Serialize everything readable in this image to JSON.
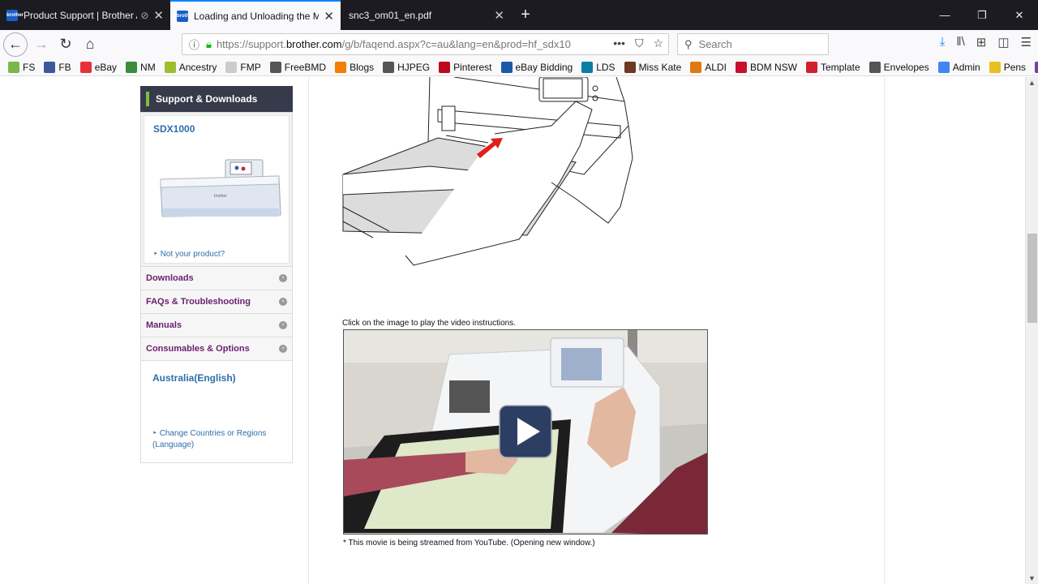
{
  "tabs": [
    {
      "title": "Product Support | Brother A",
      "active": false
    },
    {
      "title": "Loading and Unloading the Ma",
      "active": true
    },
    {
      "title": "snc3_om01_en.pdf",
      "active": false
    }
  ],
  "nav": {
    "url_prefix": "https://support.",
    "url_domain": "brother.com",
    "url_rest": "/g/b/faqend.aspx?c=au&lang=en&prod=hf_sdx10",
    "search_placeholder": "Search"
  },
  "bookmarks": [
    {
      "label": "FS",
      "icon": "tree-icon",
      "color": "#7ab648"
    },
    {
      "label": "FB",
      "icon": "facebook-icon",
      "color": "#3b5998"
    },
    {
      "label": "eBay",
      "icon": "ebay-icon",
      "color": "#e53238"
    },
    {
      "label": "NM",
      "icon": "leaf-icon",
      "color": "#3a8d3a"
    },
    {
      "label": "Ancestry",
      "icon": "ancestry-icon",
      "color": "#9cbe30"
    },
    {
      "label": "FMP",
      "icon": "fmp-icon",
      "color": "#cccccc"
    },
    {
      "label": "FreeBMD",
      "icon": "globe-icon",
      "color": "#555555"
    },
    {
      "label": "Blogs",
      "icon": "blogger-icon",
      "color": "#f57d00"
    },
    {
      "label": "HJPEG",
      "icon": "globe-icon",
      "color": "#555555"
    },
    {
      "label": "Pinterest",
      "icon": "pinterest-icon",
      "color": "#bd081c"
    },
    {
      "label": "eBay Bidding",
      "icon": "bidding-icon",
      "color": "#1c5aa8"
    },
    {
      "label": "LDS",
      "icon": "lds-icon",
      "color": "#0a7ea3"
    },
    {
      "label": "Miss Kate",
      "icon": "misskate-icon",
      "color": "#6b3a1f"
    },
    {
      "label": "ALDI",
      "icon": "pin-icon",
      "color": "#e07a10"
    },
    {
      "label": "BDM NSW",
      "icon": "bdm-icon",
      "color": "#c8102e"
    },
    {
      "label": "Template",
      "icon": "template-icon",
      "color": "#d0202e"
    },
    {
      "label": "Envelopes",
      "icon": "globe-icon",
      "color": "#555555"
    },
    {
      "label": "Admin",
      "icon": "google-icon",
      "color": "#4285f4"
    },
    {
      "label": "Pens",
      "icon": "bulb-icon",
      "color": "#e8c020"
    }
  ],
  "sidebar": {
    "header": "Support & Downloads",
    "product_name": "SDX1000",
    "not_your_product": "Not your product?",
    "menu": [
      {
        "label": "Downloads"
      },
      {
        "label": "FAQs & Troubleshooting"
      },
      {
        "label": "Manuals"
      },
      {
        "label": "Consumables & Options"
      }
    ],
    "region": "Australia(English)",
    "change_region": "Change Countries or Regions (Language)"
  },
  "main": {
    "video_caption": "Click on the image to play the video instructions.",
    "video_note": "* This movie is being streamed from YouTube. (Opening new window.)"
  }
}
